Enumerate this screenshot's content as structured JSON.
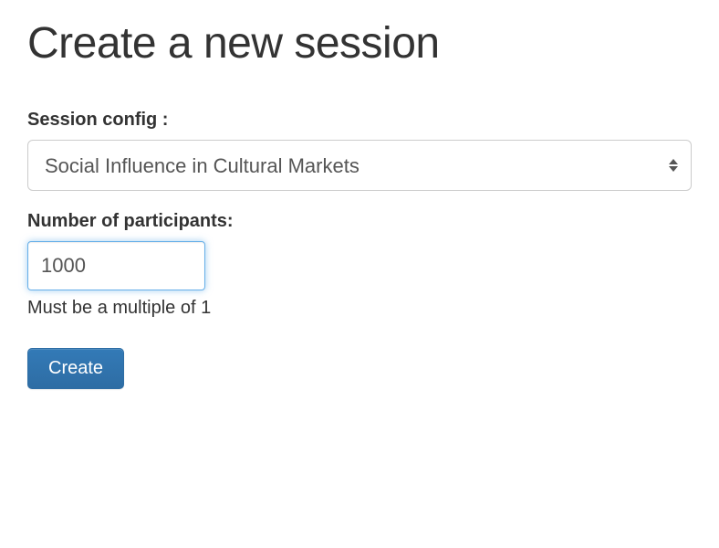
{
  "header": {
    "title": "Create a new session"
  },
  "form": {
    "session_config": {
      "label": "Session config :",
      "selected_value": "Social Influence in Cultural Markets"
    },
    "participants": {
      "label": "Number of participants:",
      "value": "1000",
      "help_text": "Must be a multiple of 1"
    },
    "submit_label": "Create"
  }
}
